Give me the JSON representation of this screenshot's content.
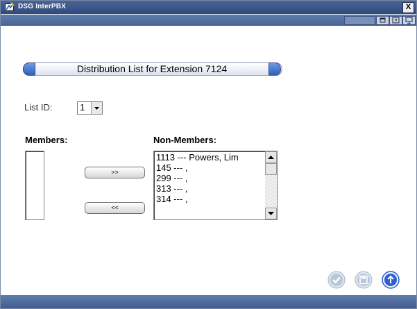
{
  "window": {
    "title": "DSG InterPBX",
    "close_label": "X"
  },
  "header": {
    "title": "Distribution List for Extension 7124"
  },
  "list_id": {
    "label": "List ID:",
    "value": "1"
  },
  "members": {
    "label": "Members:",
    "items": []
  },
  "non_members": {
    "label": "Non-Members:",
    "items": [
      "1113 --- Powers, Lim",
      "145 --- ,",
      "299 --- ,",
      "313 --- ,",
      "314 --- ,"
    ]
  },
  "buttons": {
    "add_label": ">>",
    "remove_label": "<<"
  },
  "icons": {
    "title": "window-app-icon",
    "actions": [
      "checkmark-icon",
      "save-icon",
      "upload-icon"
    ]
  },
  "colors": {
    "titlebar": "#2f4a7e",
    "accent": "#2f5fb8",
    "action_buttons": "#2c5fd0"
  }
}
